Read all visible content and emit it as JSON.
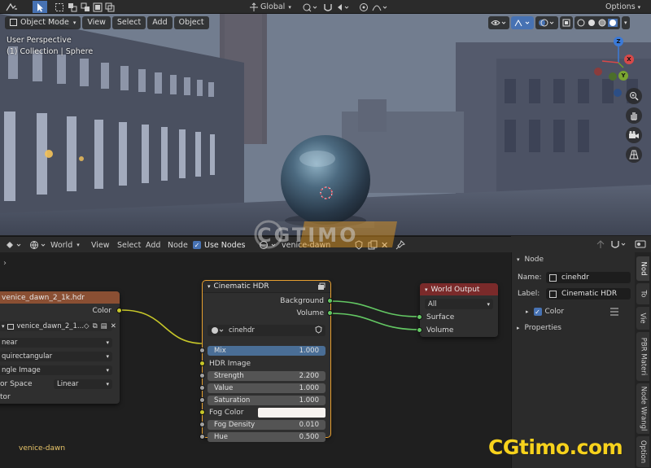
{
  "topbar": {
    "mode_label": "Object Mode",
    "menus": [
      "View",
      "Select",
      "Add",
      "Object"
    ],
    "transform_orientation": "Global",
    "options_label": "Options"
  },
  "viewport": {
    "view_name": "User Perspective",
    "collection_info": "(1) Collection | Sphere",
    "gizmo_axes": [
      "Z",
      "X",
      "Y"
    ]
  },
  "node_editor": {
    "header": {
      "shader_type": "World",
      "menus": [
        "View",
        "Select",
        "Add",
        "Node"
      ],
      "use_nodes_label": "Use Nodes",
      "datablock_name": "venice-dawn"
    },
    "frame_label": "venice-dawn",
    "env_node": {
      "title": "venice_dawn_2_1k.hdr",
      "output_color": "Color",
      "image_name": "venice_dawn_2_1...",
      "interpolation": "near",
      "projection": "quirectangular",
      "source": "ngle Image",
      "color_space_label": "or Space",
      "color_space_value": "Linear",
      "alpha_label": "tor"
    },
    "group_node": {
      "title": "Cinematic HDR",
      "output_background": "Background",
      "output_volume": "Volume",
      "group_name": "cinehdr",
      "mix_label": "Mix",
      "mix_value": "1.000",
      "hdr_image_label": "HDR Image",
      "strength_label": "Strength",
      "strength_value": "2.200",
      "value_label": "Value",
      "value_value": "1.000",
      "saturation_label": "Saturation",
      "saturation_value": "1.000",
      "fog_color_label": "Fog Color",
      "fog_density_label": "Fog Density",
      "fog_density_value": "0.010",
      "hue_label": "Hue",
      "hue_value": "0.500"
    },
    "output_node": {
      "title": "World Output",
      "target": "All",
      "input_surface": "Surface",
      "input_volume": "Volume"
    }
  },
  "sidebar": {
    "panel_title": "Node",
    "name_label": "Name:",
    "name_value": "cinehdr",
    "label_label": "Label:",
    "label_value": "Cinematic HDR",
    "color_label": "Color",
    "properties_label": "Properties",
    "tabs": [
      "Nod",
      "To",
      "Vie",
      "PBR Materi",
      "Node Wrangl",
      "Option"
    ]
  },
  "watermarks": {
    "top": "CGTIMO",
    "bottom": "CGtimo.com"
  },
  "colors": {
    "accent": "#4772b3",
    "env_node_header": "#8a4f33",
    "output_node_header": "#7a2a2a",
    "socket_yellow": "#c7c729",
    "socket_green": "#63c763",
    "socket_gray": "#a1a1a1",
    "watermark_yellow": "#f7d21c"
  }
}
